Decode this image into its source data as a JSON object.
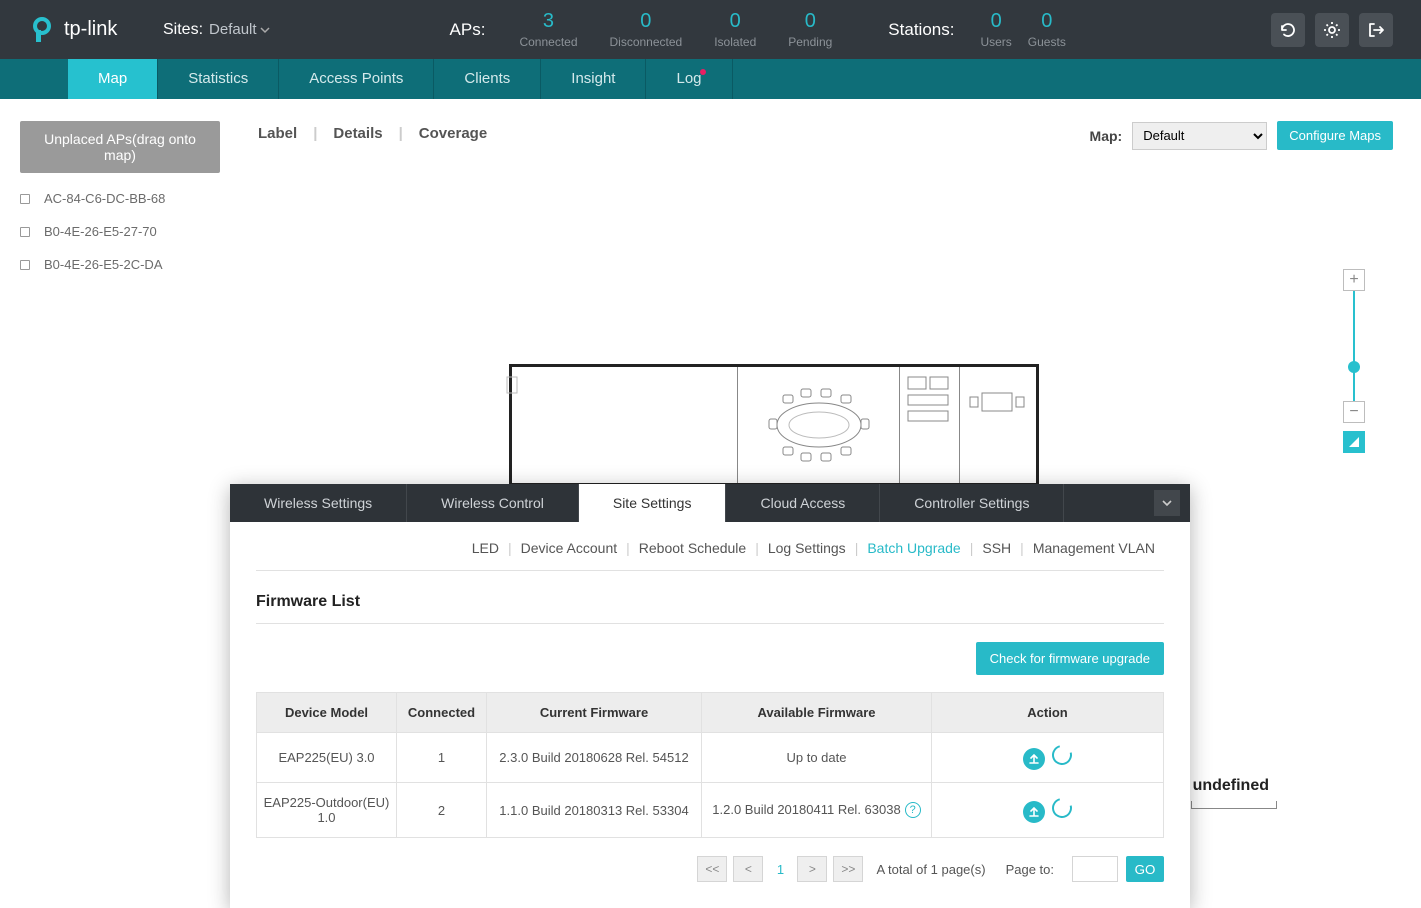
{
  "brand": "tp-link",
  "sites": {
    "label": "Sites:",
    "value": "Default"
  },
  "stats": {
    "aps_label": "APs:",
    "aps": [
      {
        "n": "3",
        "l": "Connected"
      },
      {
        "n": "0",
        "l": "Disconnected"
      },
      {
        "n": "0",
        "l": "Isolated"
      },
      {
        "n": "0",
        "l": "Pending"
      }
    ],
    "stations_label": "Stations:",
    "stations": [
      {
        "n": "0",
        "l": "Users"
      },
      {
        "n": "0",
        "l": "Guests"
      }
    ]
  },
  "nav": [
    "Map",
    "Statistics",
    "Access Points",
    "Clients",
    "Insight",
    "Log"
  ],
  "nav_active": "Map",
  "map_header": [
    "Label",
    "Details",
    "Coverage"
  ],
  "map_sel": {
    "label": "Map:",
    "value": "Default",
    "btn": "Configure Maps"
  },
  "sidebar": {
    "title": "Unplaced APs(drag onto map)",
    "items": [
      "AC-84-C6-DC-BB-68",
      "B0-4E-26-E5-27-70",
      "B0-4E-26-E5-2C-DA"
    ]
  },
  "undefined_text": "undefined",
  "modal": {
    "tabs": [
      "Wireless Settings",
      "Wireless Control",
      "Site Settings",
      "Cloud Access",
      "Controller Settings"
    ],
    "active": "Site Settings",
    "subtabs": [
      "LED",
      "Device Account",
      "Reboot Schedule",
      "Log Settings",
      "Batch Upgrade",
      "SSH",
      "Management VLAN"
    ],
    "sub_active": "Batch Upgrade",
    "section": "Firmware List",
    "check_btn": "Check for firmware upgrade",
    "cols": [
      "Device Model",
      "Connected",
      "Current Firmware",
      "Available Firmware",
      "Action"
    ],
    "rows": [
      {
        "model": "EAP225(EU) 3.0",
        "conn": "1",
        "cur": "2.3.0 Build 20180628 Rel. 54512",
        "avail": "Up to date",
        "help": false
      },
      {
        "model": "EAP225-Outdoor(EU) 1.0",
        "conn": "2",
        "cur": "1.1.0 Build 20180313 Rel. 53304",
        "avail": "1.2.0 Build 20180411 Rel. 63038",
        "help": true
      }
    ],
    "pager": {
      "first": "<<",
      "prev": "<",
      "page": "1",
      "next": ">",
      "last": ">>",
      "total": "A total of 1 page(s)",
      "pageto": "Page to:",
      "go": "GO"
    }
  }
}
